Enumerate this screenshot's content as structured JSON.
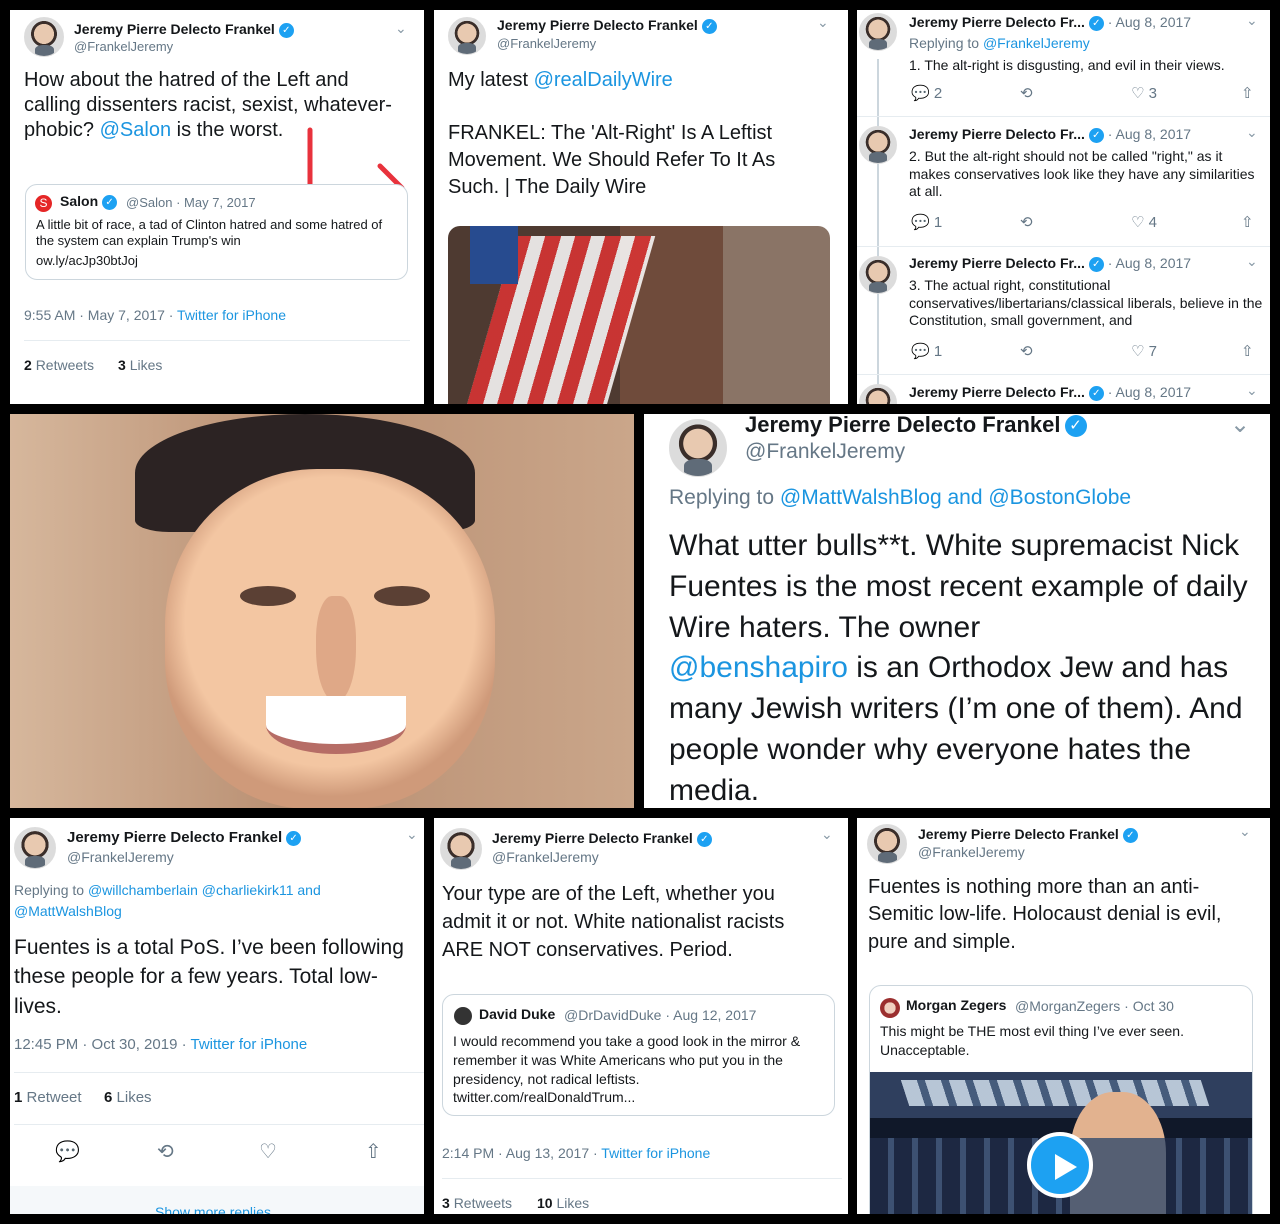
{
  "tweet1": {
    "author": "Jeremy Pierre Delecto Frankel",
    "handle": "@FrankelJeremy",
    "text_lines": [
      "How about the hatred of the Left and",
      "calling dissenters racist, sexist, whatever-",
      "phobic?"
    ],
    "mention": "@Salon",
    "text_tail": " is the worst.",
    "quote": {
      "author": "Salon",
      "handle": "@Salon",
      "date": "· May 7, 2017",
      "text": "A little bit of race, a tad of Clinton hatred and some hatred of the system can explain Trump's win",
      "link": "ow.ly/acJp30btJoj"
    },
    "timestamp": "9:55 AM · May 7, 2017 ·",
    "source": "Twitter for iPhone",
    "retweets": "2",
    "retweets_label": "Retweets",
    "likes": "3",
    "likes_label": "Likes"
  },
  "tweet2": {
    "author": "Jeremy Pierre Delecto Frankel",
    "handle": "@FrankelJeremy",
    "lead": "My latest",
    "mention": "@realDailyWire",
    "headline": "FRANKEL: The 'Alt-Right' Is A Leftist Movement. We Should Refer To It As Such. | The Daily Wire"
  },
  "thread": {
    "items": [
      {
        "author": "Jeremy Pierre Delecto Fr...",
        "date": "· Aug 8, 2017",
        "reply_prefix": "Replying to",
        "reply_to": "@FrankelJeremy",
        "text": "1. The alt-right is disgusting, and evil in their views.",
        "replies": "2",
        "likes": "3"
      },
      {
        "author": "Jeremy Pierre Delecto Fr...",
        "date": "· Aug 8, 2017",
        "text": "2. But the alt-right should not be called \"right,\" as it makes conservatives look like they have any similarities at all.",
        "replies": "1",
        "likes": "4"
      },
      {
        "author": "Jeremy Pierre Delecto Fr...",
        "date": "· Aug 8, 2017",
        "text": "3. The actual right, constitutional conservatives/libertarians/classical liberals, believe in the Constitution, small government, and",
        "replies": "1",
        "likes": "7"
      },
      {
        "author": "Jeremy Pierre Delecto Fr...",
        "date": "· Aug 8, 2017"
      }
    ]
  },
  "big_tweet": {
    "author": "Jeremy Pierre Delecto Frankel",
    "handle": "@FrankelJeremy",
    "reply_prefix": "Replying to",
    "reply_to": "@MattWalshBlog and @BostonGlobe",
    "text_1": "What utter bulls**t. White supremacist Nick Fuentes is the most recent example of daily Wire haters. The owner",
    "mention": "@benshapiro",
    "text_2": " is an Orthodox Jew and has many Jewish writers (I’m one of them). And people wonder why everyone hates the media."
  },
  "tweet4": {
    "author": "Jeremy Pierre Delecto Frankel",
    "handle": "@FrankelJeremy",
    "reply_prefix": "Replying to",
    "reply_to": "@willchamberlain @charliekirk11 and @MattWalshBlog",
    "text": "Fuentes is a total PoS. I’ve been following these people for a few years. Total low-lives.",
    "timestamp": "12:45 PM · Oct 30, 2019 ·",
    "source": "Twitter for iPhone",
    "retweets": "1",
    "retweets_label": "Retweet",
    "likes": "6",
    "likes_label": "Likes",
    "more_replies": "Show more replies"
  },
  "tweet5": {
    "author": "Jeremy Pierre Delecto Frankel",
    "handle": "@FrankelJeremy",
    "text": "Your type are of the Left, whether you admit it or not. White nationalist racists ARE NOT conservatives. Period.",
    "quote": {
      "author": "David Duke",
      "handle": "@DrDavidDuke",
      "date": "· Aug 12, 2017",
      "text": "I would recommend you take a good look in the mirror & remember it was White Americans who put you in the presidency, not radical leftists.",
      "link": "twitter.com/realDonaldTrum..."
    },
    "timestamp": "2:14 PM · Aug 13, 2017 ·",
    "source": "Twitter for iPhone",
    "retweets": "3",
    "retweets_label": "Retweets",
    "likes": "10",
    "likes_label": "Likes"
  },
  "tweet6": {
    "author": "Jeremy Pierre Delecto Frankel",
    "handle": "@FrankelJeremy",
    "text": "Fuentes is nothing more than an anti-Semitic low-life. Holocaust denial is evil, pure and simple.",
    "quote": {
      "author": "Morgan Zegers",
      "handle": "@MorganZegers",
      "date": "· Oct 30",
      "text": "This might be THE most evil thing I’ve ever seen. Unacceptable."
    }
  },
  "colors": {
    "link": "#1b95e0",
    "verified": "#1da1f2",
    "arrow": "#e8323c"
  },
  "icons": [
    "verified-badge-icon",
    "chevron-down-icon",
    "reply-icon",
    "retweet-icon",
    "like-icon",
    "share-icon",
    "play-icon"
  ]
}
